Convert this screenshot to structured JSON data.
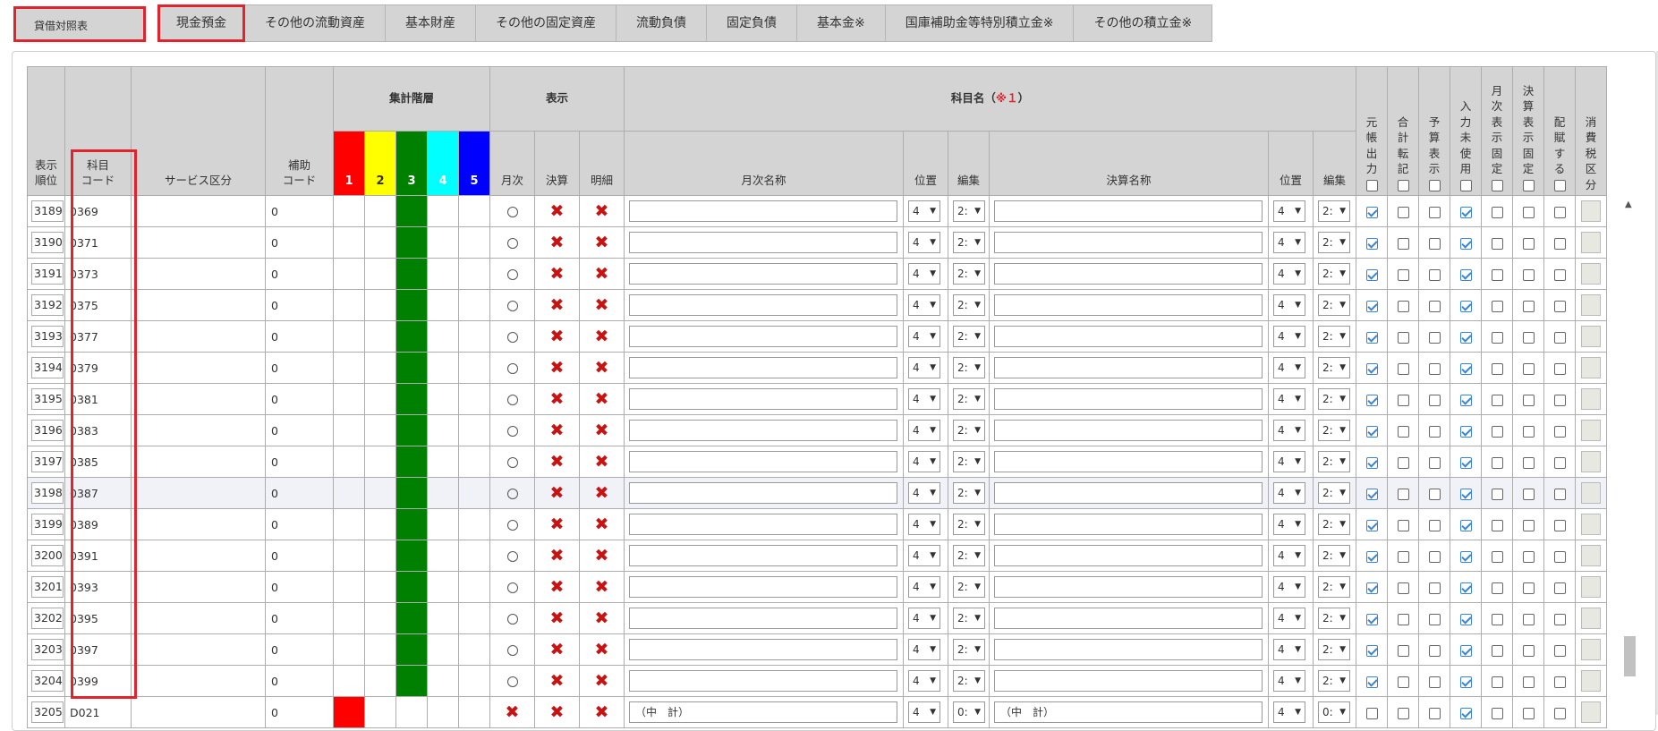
{
  "main_tab": "貸借対照表",
  "tabs": [
    "現金預金",
    "その他の流動資産",
    "基本財産",
    "その他の固定資産",
    "流動負債",
    "固定負債",
    "基本金※",
    "国庫補助金等特別積立金※",
    "その他の積立金※"
  ],
  "header": {
    "display_order": "表示\n順位",
    "account_code": "科目\nコード",
    "service": "サービス区分",
    "aux_code": "補助\nコード",
    "agg_level": "集計階層",
    "levels": [
      "1",
      "2",
      "3",
      "4",
      "5"
    ],
    "display": "表示",
    "monthly": "月次",
    "settlement": "決算",
    "detail": "明細",
    "account_name": "科目名（",
    "account_name_note": "※１",
    "account_name_close": "）",
    "monthly_name": "月次名称",
    "position": "位置",
    "edit": "編集",
    "settlement_name": "決算名称",
    "flags": [
      "元帳出力",
      "合計転記",
      "予算表示",
      "入力未使用",
      "月次表示固定",
      "決算表示固定",
      "配賦する",
      "消費税区分"
    ]
  },
  "rows": [
    {
      "seq": "3189",
      "code": "0369",
      "aux": "0"
    },
    {
      "seq": "3190",
      "code": "0371",
      "aux": "0"
    },
    {
      "seq": "3191",
      "code": "0373",
      "aux": "0"
    },
    {
      "seq": "3192",
      "code": "0375",
      "aux": "0"
    },
    {
      "seq": "3193",
      "code": "0377",
      "aux": "0"
    },
    {
      "seq": "3194",
      "code": "0379",
      "aux": "0"
    },
    {
      "seq": "3195",
      "code": "0381",
      "aux": "0"
    },
    {
      "seq": "3196",
      "code": "0383",
      "aux": "0"
    },
    {
      "seq": "3197",
      "code": "0385",
      "aux": "0"
    },
    {
      "seq": "3198",
      "code": "0387",
      "aux": "0"
    },
    {
      "seq": "3199",
      "code": "0389",
      "aux": "0"
    },
    {
      "seq": "3200",
      "code": "0391",
      "aux": "0"
    },
    {
      "seq": "3201",
      "code": "0393",
      "aux": "0"
    },
    {
      "seq": "3202",
      "code": "0395",
      "aux": "0"
    },
    {
      "seq": "3203",
      "code": "0397",
      "aux": "0"
    },
    {
      "seq": "3204",
      "code": "0399",
      "aux": "0"
    }
  ],
  "partial_row": {
    "seq": "3205",
    "code": "D021",
    "aux": "0",
    "monthly_name": "（中　計）",
    "settlement_name": "（中　計）",
    "pos": "4",
    "edit": "0:"
  },
  "row_defaults": {
    "pos": "4",
    "edit": "2:",
    "radio_symbol": "",
    "x_symbol": "✖"
  },
  "colors": {
    "level1": "#ff0000",
    "level2": "#ffff00",
    "level3": "#008000",
    "level4": "#00ffff",
    "level5": "#0000ff",
    "highlight": "#e0232d"
  }
}
